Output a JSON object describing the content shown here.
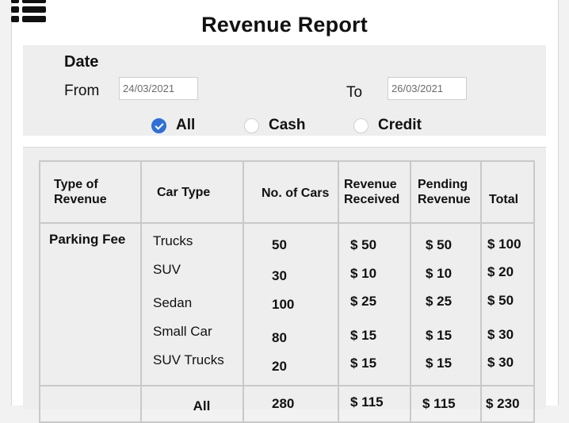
{
  "header": {
    "title": "Revenue Report",
    "menu_icon": "list-menu-icon"
  },
  "filters": {
    "date_label": "Date",
    "from_label": "From",
    "from_value": "24/03/2021",
    "to_label": "To",
    "to_value": "26/03/2021",
    "payment_options": [
      {
        "label": "All",
        "selected": true
      },
      {
        "label": "Cash",
        "selected": false
      },
      {
        "label": "Credit",
        "selected": false
      }
    ]
  },
  "table": {
    "columns": [
      "Type of Revenue",
      "Car Type",
      "No. of Cars",
      "Revenue Received",
      "Pending Revenue",
      "Total"
    ],
    "revenue_type": "Parking Fee",
    "rows": [
      {
        "car_type": "Trucks",
        "cars": "50",
        "received": "$ 50",
        "pending": "$ 50",
        "total": "$ 100"
      },
      {
        "car_type": "SUV",
        "cars": "30",
        "received": "$ 10",
        "pending": "$ 10",
        "total": "$ 20"
      },
      {
        "car_type": "Sedan",
        "cars": "100",
        "received": "$ 25",
        "pending": "$ 25",
        "total": "$ 50"
      },
      {
        "car_type": "Small Car",
        "cars": "80",
        "received": "$ 15",
        "pending": "$ 15",
        "total": "$ 30"
      },
      {
        "car_type": "SUV Trucks",
        "cars": "20",
        "received": "$ 15",
        "pending": "$ 15",
        "total": "$ 30"
      }
    ],
    "totals": {
      "label": "All",
      "cars": "280",
      "received": "$ 115",
      "pending": "$ 115",
      "total": "$ 230"
    }
  },
  "colors": {
    "accent": "#2f6fd8",
    "panel": "#eeeeee",
    "border": "#c9c9c9"
  }
}
